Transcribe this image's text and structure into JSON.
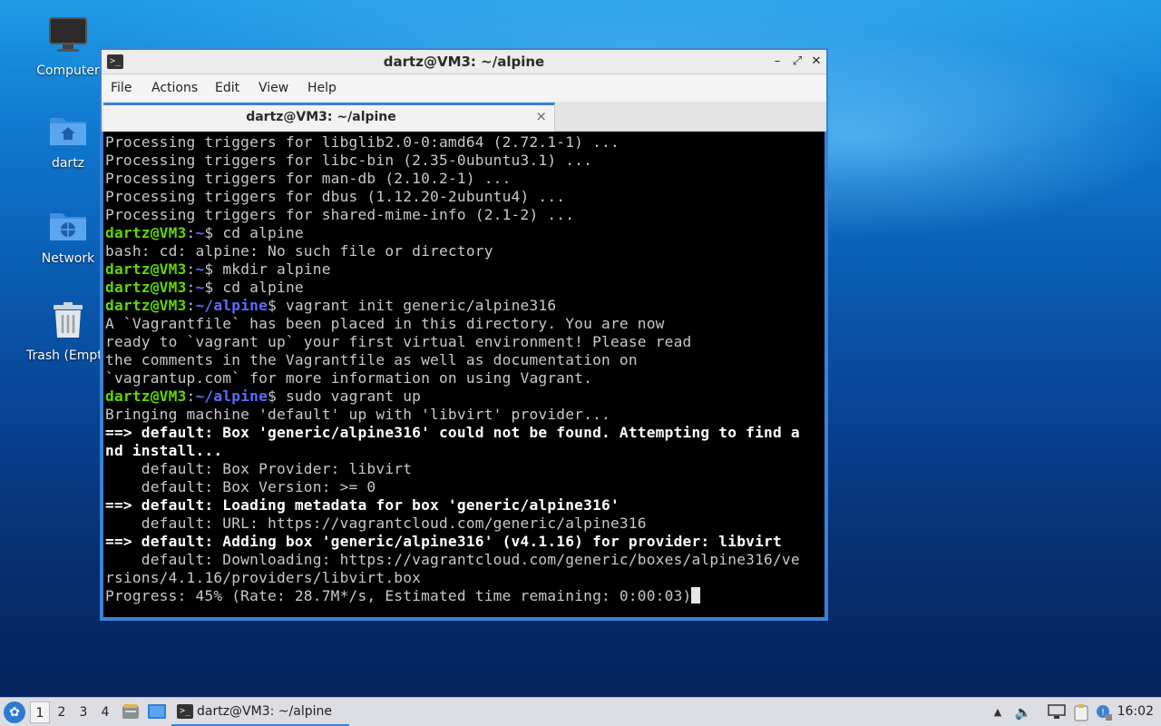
{
  "desktop": {
    "icons": [
      {
        "label": "Computer",
        "icon": "monitor-icon"
      },
      {
        "label": "dartz",
        "icon": "home-folder-icon"
      },
      {
        "label": "Network",
        "icon": "network-folder-icon"
      },
      {
        "label": "Trash (Empty)",
        "icon": "trash-icon"
      }
    ]
  },
  "window": {
    "title": "dartz@VM3: ~/alpine",
    "controls": {
      "minimize": "–",
      "maximize": "⤢",
      "close": "✕"
    },
    "menu": [
      "File",
      "Actions",
      "Edit",
      "View",
      "Help"
    ],
    "tab": {
      "label": "dartz@VM3: ~/alpine",
      "close": "×"
    }
  },
  "terminal": {
    "prompt_user": "dartz@VM3",
    "lines": [
      {
        "kind": "out",
        "text": "Processing triggers for libglib2.0-0:amd64 (2.72.1-1) ..."
      },
      {
        "kind": "out",
        "text": "Processing triggers for libc-bin (2.35-0ubuntu3.1) ..."
      },
      {
        "kind": "out",
        "text": "Processing triggers for man-db (2.10.2-1) ..."
      },
      {
        "kind": "out",
        "text": "Processing triggers for dbus (1.12.20-2ubuntu4) ..."
      },
      {
        "kind": "out",
        "text": "Processing triggers for shared-mime-info (2.1-2) ..."
      },
      {
        "kind": "prompt",
        "path": "~",
        "cmd": " cd alpine"
      },
      {
        "kind": "out",
        "text": "bash: cd: alpine: No such file or directory"
      },
      {
        "kind": "prompt",
        "path": "~",
        "cmd": " mkdir alpine"
      },
      {
        "kind": "prompt",
        "path": "~",
        "cmd": " cd alpine"
      },
      {
        "kind": "prompt",
        "path": "~/alpine",
        "cmd": " vagrant init generic/alpine316"
      },
      {
        "kind": "out",
        "text": "A `Vagrantfile` has been placed in this directory. You are now"
      },
      {
        "kind": "out",
        "text": "ready to `vagrant up` your first virtual environment! Please read"
      },
      {
        "kind": "out",
        "text": "the comments in the Vagrantfile as well as documentation on"
      },
      {
        "kind": "out",
        "text": "`vagrantup.com` for more information on using Vagrant."
      },
      {
        "kind": "prompt",
        "path": "~/alpine",
        "cmd": " sudo vagrant up"
      },
      {
        "kind": "out",
        "text": "Bringing machine 'default' up with 'libvirt' provider..."
      },
      {
        "kind": "bold",
        "text": "==> default: Box 'generic/alpine316' could not be found. Attempting to find a"
      },
      {
        "kind": "bold",
        "text": "nd install..."
      },
      {
        "kind": "out",
        "text": "    default: Box Provider: libvirt"
      },
      {
        "kind": "out",
        "text": "    default: Box Version: >= 0"
      },
      {
        "kind": "bold",
        "text": "==> default: Loading metadata for box 'generic/alpine316'"
      },
      {
        "kind": "out",
        "text": "    default: URL: https://vagrantcloud.com/generic/alpine316"
      },
      {
        "kind": "bold",
        "text": "==> default: Adding box 'generic/alpine316' (v4.1.16) for provider: libvirt"
      },
      {
        "kind": "out",
        "text": "    default: Downloading: https://vagrantcloud.com/generic/boxes/alpine316/ve"
      },
      {
        "kind": "out",
        "text": "rsions/4.1.16/providers/libvirt.box"
      },
      {
        "kind": "out",
        "text": "Progress: 45% (Rate: 28.7M*/s, Estimated time remaining: 0:00:03)",
        "cursor": true
      }
    ]
  },
  "taskbar": {
    "workspaces": [
      "1",
      "2",
      "3",
      "4"
    ],
    "active_workspace": "1",
    "task": {
      "label": "dartz@VM3: ~/alpine"
    },
    "clock": "16:02"
  },
  "colors": {
    "accent": "#3b82d6",
    "prompt_user": "#5fd700",
    "prompt_path": "#5c6bff"
  }
}
